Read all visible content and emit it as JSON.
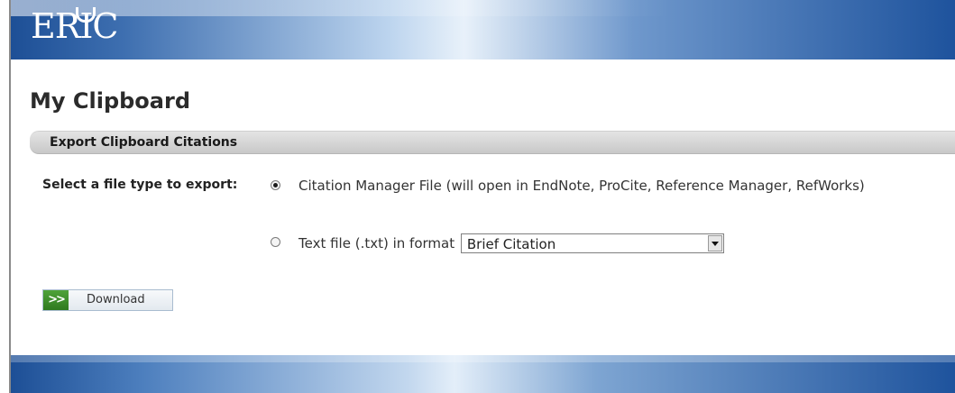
{
  "header": {
    "logo_text": "ERIC"
  },
  "page": {
    "title": "My Clipboard"
  },
  "export_section": {
    "title": "Export Clipboard Citations",
    "file_type_label": "Select a file type to export:",
    "options": [
      {
        "label": "Citation Manager File (will open in EndNote, ProCite, Reference Manager, RefWorks)",
        "selected": true
      },
      {
        "label": "Text file (.txt) in format",
        "selected": false
      }
    ],
    "format_select": {
      "selected": "Brief Citation"
    },
    "download_button": {
      "label": "Download",
      "icon": "double-chevron-right-icon"
    }
  },
  "colors": {
    "header_blue": "#1d4f96",
    "section_bar_gray": "#c8c8c8",
    "download_icon_green": "#3a8f2a"
  }
}
